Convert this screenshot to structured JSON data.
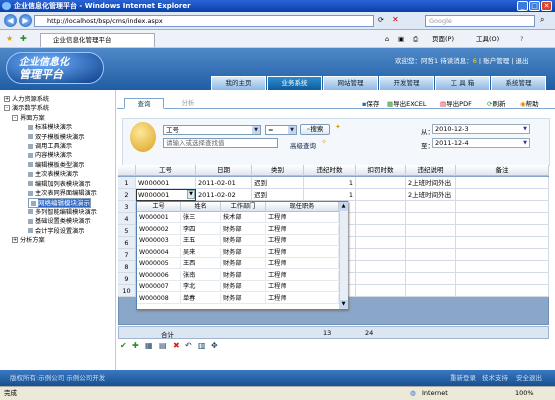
{
  "window": {
    "title": "企业信息化管理平台 - Windows Internet Explorer",
    "min": "_",
    "max": "□",
    "close": "✕"
  },
  "browser": {
    "url": "http://localhost/bsp/cms/index.aspx",
    "search_placeholder": "Google",
    "tab_title": "企业信息化管理平台",
    "cmd_page": "页面(P)",
    "cmd_tools": "工具(O)"
  },
  "header": {
    "logo_line1": "企业信息化",
    "logo_line2": "管理平台",
    "welcome": "欢迎您：阿哲1 待读消息：",
    "msg_count": "6",
    "account": "账户管理",
    "logout": "退出",
    "nav": [
      "我的主页",
      "业务系统",
      "网站管理",
      "开发管理",
      "工 具 箱",
      "系统管理"
    ],
    "active_nav": 1
  },
  "sidebar": {
    "items": [
      {
        "label": "人力资源系统",
        "level": 0,
        "toggle": "+"
      },
      {
        "label": "演示数学系统",
        "level": 0,
        "toggle": "-"
      },
      {
        "label": "界面方案",
        "level": 1,
        "toggle": "-"
      },
      {
        "label": "标准模块演示",
        "level": 2
      },
      {
        "label": "双子模板模块演示",
        "level": 2
      },
      {
        "label": "调用工具演示",
        "level": 2
      },
      {
        "label": "内容模块演示",
        "level": 2
      },
      {
        "label": "编辑模板类型演示",
        "level": 2
      },
      {
        "label": "主次表模块演示",
        "level": 2
      },
      {
        "label": "编辑加列表模块演示",
        "level": 2
      },
      {
        "label": "主次表同界面编辑演示",
        "level": 2
      },
      {
        "label": "网络编辑模块演示",
        "level": 2,
        "selected": true
      },
      {
        "label": "多列智能编辑模块演示",
        "level": 2
      },
      {
        "label": "基础设置类模块演示",
        "level": 2
      },
      {
        "label": "会计字段设置演示",
        "level": 2
      },
      {
        "label": "分析方案",
        "level": 1,
        "toggle": "+"
      }
    ]
  },
  "main": {
    "subtabs": [
      "查询",
      "分析"
    ],
    "toolbar": {
      "save": "保存",
      "excel": "导出EXCEL",
      "pdf": "导出PDF",
      "refresh": "刷新",
      "help": "帮助"
    },
    "query": {
      "field": "工号",
      "operator": "=",
      "search_button": "搜索",
      "placeholder": "请输入或选择查找值",
      "advanced": "高级查询",
      "from_label": "从：",
      "from_date": "2010-12-3",
      "to_label": "至：",
      "to_date": "2011-12-4"
    },
    "grid": {
      "columns": [
        "工号",
        "日期",
        "类别",
        "违纪时数",
        "扣罚时数",
        "违纪说明",
        "备注"
      ],
      "rows": [
        {
          "n": "1",
          "id": "W000001",
          "date": "2011-02-01",
          "type": "迟到",
          "hours": "1",
          "deduct": "",
          "note": "2上班时间外出",
          "remark": ""
        },
        {
          "n": "2",
          "id": "W000001",
          "date": "2011-02-02",
          "type": "迟到",
          "hours": "1",
          "deduct": "",
          "note": "2上班时间外出",
          "remark": ""
        },
        {
          "n": "3",
          "id": "",
          "date": "",
          "type": "",
          "hours": "",
          "deduct": "",
          "note": "",
          "remark": ""
        },
        {
          "n": "4",
          "id": "",
          "date": "",
          "type": "",
          "hours": "",
          "deduct": "",
          "note": "",
          "remark": ""
        },
        {
          "n": "5",
          "id": "",
          "date": "",
          "type": "",
          "hours": "",
          "deduct": "",
          "note": "",
          "remark": ""
        },
        {
          "n": "6",
          "id": "",
          "date": "",
          "type": "",
          "hours": "",
          "deduct": "",
          "note": "",
          "remark": ""
        },
        {
          "n": "7",
          "id": "",
          "date": "",
          "type": "",
          "hours": "",
          "deduct": "",
          "note": "",
          "remark": ""
        },
        {
          "n": "8",
          "id": "",
          "date": "",
          "type": "",
          "hours": "",
          "deduct": "",
          "note": "",
          "remark": ""
        },
        {
          "n": "9",
          "id": "",
          "date": "",
          "type": "",
          "hours": "",
          "deduct": "",
          "note": "",
          "remark": ""
        },
        {
          "n": "10",
          "id": "",
          "date": "",
          "type": "",
          "hours": "",
          "deduct": "",
          "note": "",
          "remark": ""
        }
      ],
      "summary": {
        "label": "合计",
        "hours": "13",
        "deduct": "24"
      }
    },
    "popup": {
      "columns": [
        "工号",
        "姓名",
        "工作部门",
        "现任职务"
      ],
      "rows": [
        [
          "W000001",
          "张三",
          "技术部",
          "工程师"
        ],
        [
          "W000002",
          "李四",
          "财务部",
          "工程师"
        ],
        [
          "W000003",
          "王五",
          "财务部",
          "工程师"
        ],
        [
          "W000004",
          "吴来",
          "财务部",
          "工程师"
        ],
        [
          "W000005",
          "王西",
          "财务部",
          "工程师"
        ],
        [
          "W000006",
          "张南",
          "财务部",
          "工程师"
        ],
        [
          "W000007",
          "李北",
          "财务部",
          "工程师"
        ],
        [
          "W000008",
          "单春",
          "财务部",
          "工程师"
        ]
      ]
    }
  },
  "footer": {
    "left": "版权所有:示例公司  示例公司开发",
    "right": [
      "重新登录",
      "技术支持",
      "安全退出"
    ]
  },
  "status": {
    "left": "完成",
    "zone": "Internet",
    "zoom": "100%"
  },
  "colors": {
    "header": "#1f5da3",
    "accent": "#316ac5",
    "grid_bg": "#8aa6c8"
  }
}
